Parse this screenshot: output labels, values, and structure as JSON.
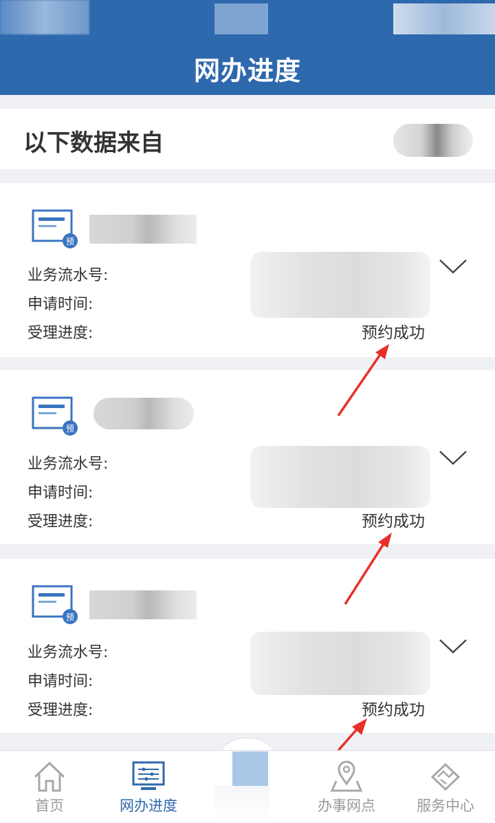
{
  "header": {
    "title": "网办进度"
  },
  "source": {
    "label": "以下数据来自"
  },
  "cards": [
    {
      "icon_badge": "预",
      "serial_label": "业务流水号:",
      "time_label": "申请时间:",
      "progress_label": "受理进度:",
      "status": "预约成功"
    },
    {
      "icon_badge": "预",
      "serial_label": "业务流水号:",
      "time_label": "申请时间:",
      "progress_label": "受理进度:",
      "status": "预约成功"
    },
    {
      "icon_badge": "预",
      "serial_label": "业务流水号:",
      "time_label": "申请时间:",
      "progress_label": "受理进度:",
      "status": "预约成功"
    }
  ],
  "nav": [
    {
      "label": "首页",
      "icon": "home-icon",
      "active": false
    },
    {
      "label": "网办进度",
      "icon": "monitor-icon",
      "active": true
    },
    {
      "label": "",
      "icon": "center-icon",
      "active": false
    },
    {
      "label": "办事网点",
      "icon": "map-pin-icon",
      "active": false
    },
    {
      "label": "服务中心",
      "icon": "handshake-icon",
      "active": false
    }
  ],
  "colors": {
    "primary": "#2e68ad",
    "annotation": "#e8302a",
    "inactive": "#9a9a9a"
  }
}
